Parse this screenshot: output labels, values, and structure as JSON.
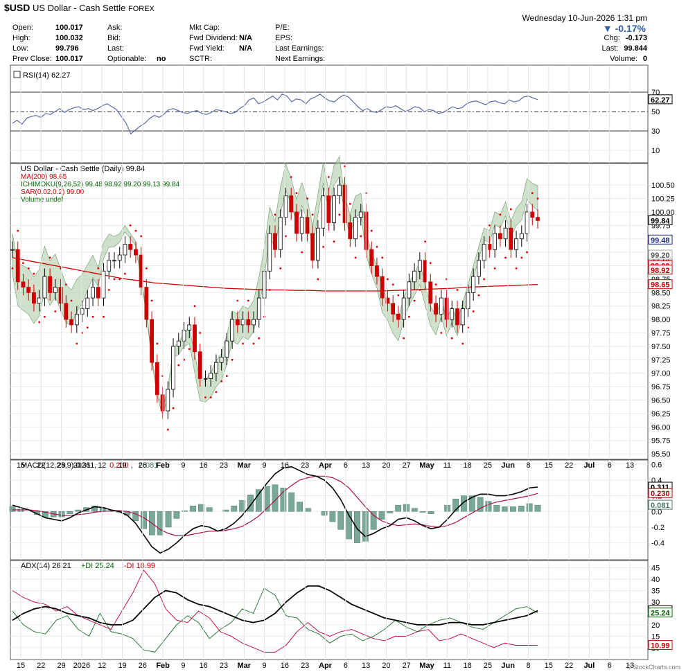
{
  "header": {
    "symbol": "$USD",
    "name": "US Dollar - Cash Settle",
    "exchange": "FOREX",
    "datetime": "Wednesday  10-Jun-2026  1:31 pm",
    "brand": "© StockCharts.com",
    "change_pct": "-0.17%",
    "quotes": [
      {
        "label": "Open:",
        "value": "100.017"
      },
      {
        "label": "High:",
        "value": "100.032"
      },
      {
        "label": "Low:",
        "value": "99.796"
      },
      {
        "label": "Prev Close:",
        "value": "100.017"
      },
      {
        "label": "Ask:",
        "value": ""
      },
      {
        "label": "Bid:",
        "value": ""
      },
      {
        "label": "Last:",
        "value": ""
      },
      {
        "label": "Optionable:",
        "value": "no"
      },
      {
        "label": "Mkt Cap:",
        "value": ""
      },
      {
        "label": "Fwd Dividend:",
        "value": "N/A"
      },
      {
        "label": "Fwd Yield:",
        "value": "N/A"
      },
      {
        "label": "SCTR:",
        "value": ""
      },
      {
        "label": "P/E:",
        "value": ""
      },
      {
        "label": "EPS:",
        "value": ""
      },
      {
        "label": "Last Earnings:",
        "value": ""
      },
      {
        "label": "Next Earnings:",
        "value": ""
      },
      {
        "label": "Chg:",
        "value": "-0.173"
      },
      {
        "label": "Last:",
        "value": "99.844"
      },
      {
        "label": "Volume:",
        "value": "0"
      }
    ]
  },
  "chart_data": {
    "type": "line",
    "x_labels": [
      "15",
      "22",
      "29",
      "2026",
      "12",
      "19",
      "26",
      "Feb",
      "9",
      "16",
      "23",
      "Mar",
      "9",
      "16",
      "23",
      "Apr",
      "6",
      "13",
      "20",
      "27",
      "May",
      "11",
      "18",
      "25",
      "Jun",
      "8",
      "15",
      "22",
      "Jul",
      "6",
      "13"
    ],
    "rsi": {
      "legend": "RSI(14) 62.27",
      "ylim": [
        0,
        95
      ],
      "ticks": [
        70,
        50,
        30,
        10
      ],
      "levels": [
        70,
        50,
        30
      ],
      "last_label": "62.27",
      "values": [
        38,
        41,
        37,
        43,
        45,
        46,
        44,
        48,
        47,
        50,
        53,
        49,
        52,
        54,
        55,
        52,
        53,
        51,
        53,
        56,
        58,
        55,
        52,
        45,
        38,
        27,
        31,
        35,
        38,
        43,
        46,
        44,
        47,
        52,
        53,
        51,
        49,
        48,
        50,
        51,
        48,
        47,
        49,
        52,
        51,
        50,
        48,
        49,
        53,
        56,
        62,
        64,
        58,
        60,
        63,
        66,
        62,
        68,
        66,
        60,
        63,
        62,
        58,
        63,
        65,
        68,
        64,
        61,
        60,
        64,
        67,
        65,
        60,
        55,
        51,
        53,
        50,
        49,
        52,
        55,
        54,
        56,
        53,
        50,
        52,
        55,
        54,
        50,
        52,
        51,
        48,
        49,
        52,
        55,
        53,
        54,
        58,
        60,
        61,
        59,
        57,
        60,
        61,
        59,
        58,
        62,
        60,
        61,
        65,
        66,
        64,
        62.27
      ]
    },
    "price": {
      "legend": [
        "US Dollar - Cash Settle (Daily) 99.84",
        "MA(200) 98.65",
        "ICHIMOKU(9,26,52) 99.48 98.92 99.20 99.13 99.84",
        "SAR(0.02,0.2) 99.00",
        "Volume undef"
      ],
      "ylim": [
        95.45,
        100.85
      ],
      "ticks": [
        100.5,
        100.25,
        100.0,
        99.75,
        99.5,
        99.25,
        99.0,
        98.75,
        98.5,
        98.25,
        98.0,
        97.75,
        97.5,
        97.25,
        97.0,
        96.75,
        96.5,
        96.25,
        96.0,
        95.75,
        95.5
      ],
      "tick_labels": [
        "100.50",
        "100.25",
        "100.00",
        "99.75",
        "",
        "99.25",
        "",
        "98.75",
        "98.50",
        "98.25",
        "98.00",
        "97.75",
        "97.50",
        "97.25",
        "97.00",
        "96.75",
        "96.50",
        "96.25",
        "96.00",
        "95.75",
        "95.50"
      ],
      "value_tags": [
        {
          "text": "99.84",
          "value": 99.84,
          "bg": "#ffffff",
          "fg": "#000000",
          "border": "#000000"
        },
        {
          "text": "99.48",
          "value": 99.48,
          "bg": "#ffffff",
          "fg": "#1a237e",
          "border": "#1a237e"
        },
        {
          "text": "99.13",
          "value": 99.13,
          "bg": "#ffffff",
          "fg": "#333333",
          "border": "#555555"
        },
        {
          "text": "99.20",
          "value": 99.2,
          "bg": "#ffffff",
          "fg": "#555555",
          "border": "#aaaaaa"
        },
        {
          "text": "99.00",
          "value": 99.0,
          "bg": "#ffffff",
          "fg": "#cc0000",
          "border": "#cc0000"
        },
        {
          "text": "98.92",
          "value": 98.92,
          "bg": "#ffffff",
          "fg": "#cc0000",
          "border": "#cc0000"
        },
        {
          "text": "98.65",
          "value": 98.65,
          "bg": "#ffffff",
          "fg": "#cc0000",
          "border": "#cc0000"
        }
      ],
      "closes": [
        99.3,
        98.7,
        98.6,
        98.5,
        98.3,
        98.4,
        98.8,
        98.5,
        98.6,
        98.3,
        98.0,
        97.9,
        98.1,
        98.2,
        98.4,
        98.6,
        98.4,
        98.9,
        99.1,
        99.1,
        99.2,
        99.4,
        99.3,
        99.2,
        98.6,
        98.0,
        97.2,
        96.6,
        96.3,
        96.7,
        97.5,
        97.6,
        97.8,
        97.9,
        97.4,
        96.9,
        96.9,
        97.0,
        97.2,
        97.3,
        97.6,
        98.0,
        97.9,
        98.0,
        97.9,
        98.0,
        98.4,
        98.9,
        99.6,
        99.3,
        99.9,
        100.3,
        100.0,
        99.6,
        99.9,
        99.6,
        99.1,
        99.7,
        100.3,
        99.8,
        100.3,
        100.5,
        99.8,
        99.5,
        99.9,
        100.0,
        99.3,
        99.0,
        98.8,
        98.4,
        98.3,
        98.1,
        98.0,
        98.4,
        98.7,
        98.9,
        99.1,
        98.7,
        98.3,
        98.1,
        98.4,
        98.0,
        98.2,
        97.9,
        98.2,
        98.5,
        98.8,
        99.1,
        99.4,
        99.3,
        99.6,
        99.5,
        99.7,
        99.3,
        99.5,
        99.6,
        100.0,
        99.9,
        99.84
      ],
      "ma200": [
        99.15,
        99.1,
        99.05,
        99.0,
        98.95,
        98.9,
        98.85,
        98.8,
        98.75,
        98.72,
        98.68,
        98.66,
        98.64,
        98.62,
        98.6,
        98.58,
        98.57,
        98.56,
        98.55,
        98.55,
        98.54,
        98.54,
        98.53,
        98.53,
        98.53,
        98.53,
        98.53,
        98.54,
        98.55,
        98.56,
        98.57,
        98.58,
        98.6,
        98.61,
        98.62,
        98.63,
        98.64,
        98.65
      ]
    },
    "macd": {
      "legend": "MACD(12,26,9) 0.311, 0.230, 0.081",
      "legend_parts": [
        "MACD(12,26,9) 0.311, ",
        "0.230",
        ", ",
        "0.081"
      ],
      "ylim": [
        -0.58,
        0.62
      ],
      "ticks": [
        0.6,
        0.4,
        0.2,
        0.0,
        -0.2,
        -0.4
      ],
      "tick_labels": [
        "0.6",
        "0.4",
        "0.2",
        "0.0",
        "-0.2",
        "-0.4"
      ],
      "value_tags": [
        {
          "text": "0.311",
          "value": 0.311,
          "fg": "#000000",
          "border": "#000000"
        },
        {
          "text": "0.230",
          "value": 0.23,
          "fg": "#aa0000",
          "border": "#aa0000"
        },
        {
          "text": "0.081",
          "value": 0.081,
          "fg": "#4a7a6a",
          "border": "#4a7a6a"
        }
      ],
      "macd": [
        0.08,
        0.05,
        0.02,
        -0.03,
        -0.08,
        -0.1,
        -0.12,
        -0.08,
        -0.02,
        0.02,
        0.06,
        0.05,
        0.02,
        0.0,
        -0.05,
        -0.15,
        -0.3,
        -0.45,
        -0.53,
        -0.48,
        -0.4,
        -0.3,
        -0.22,
        -0.18,
        -0.2,
        -0.25,
        -0.22,
        -0.15,
        -0.05,
        0.08,
        0.22,
        0.36,
        0.48,
        0.55,
        0.57,
        0.52,
        0.47,
        0.45,
        0.4,
        0.3,
        0.15,
        -0.05,
        -0.22,
        -0.32,
        -0.28,
        -0.22,
        -0.18,
        -0.1,
        -0.08,
        -0.12,
        -0.18,
        -0.22,
        -0.2,
        -0.1,
        0.02,
        0.12,
        0.18,
        0.22,
        0.22,
        0.2,
        0.2,
        0.22,
        0.25,
        0.3,
        0.311
      ],
      "signal": [
        0.02,
        0.02,
        0.02,
        0.01,
        -0.01,
        -0.03,
        -0.05,
        -0.05,
        -0.04,
        -0.03,
        -0.01,
        0.0,
        0.01,
        0.01,
        0.0,
        -0.03,
        -0.08,
        -0.15,
        -0.23,
        -0.28,
        -0.31,
        -0.31,
        -0.29,
        -0.27,
        -0.25,
        -0.25,
        -0.24,
        -0.22,
        -0.19,
        -0.13,
        -0.06,
        0.04,
        0.14,
        0.25,
        0.33,
        0.4,
        0.43,
        0.45,
        0.45,
        0.43,
        0.38,
        0.3,
        0.18,
        0.06,
        -0.05,
        -0.12,
        -0.16,
        -0.18,
        -0.17,
        -0.16,
        -0.17,
        -0.19,
        -0.2,
        -0.18,
        -0.14,
        -0.08,
        -0.02,
        0.04,
        0.09,
        0.12,
        0.14,
        0.16,
        0.18,
        0.2,
        0.23
      ]
    },
    "adx": {
      "legend_parts": [
        "ADX(14) 26.21 ",
        "+DI 25.24 ",
        "-DI 10.99"
      ],
      "ylim": [
        6,
        47
      ],
      "ticks": [
        45,
        40,
        35,
        30,
        25,
        20,
        15,
        10
      ],
      "value_tags": [
        {
          "text": "26.21",
          "value": 26.21,
          "fg": "#000000",
          "border": "#000000"
        },
        {
          "text": "25.24",
          "value": 25.24,
          "fg": "#006600",
          "border": "#006600"
        },
        {
          "text": "10.99",
          "value": 10.99,
          "fg": "#cc0000",
          "border": "#cc0000"
        }
      ],
      "adx": [
        22,
        25,
        27,
        28,
        27,
        25,
        24,
        23,
        21,
        20,
        20,
        22,
        27,
        32,
        35,
        34,
        31,
        29,
        28,
        26,
        24,
        22,
        21,
        22,
        25,
        30,
        34,
        37,
        37,
        35,
        32,
        29,
        27,
        25,
        23,
        22,
        21,
        20,
        20,
        20,
        21,
        21,
        20,
        20,
        21,
        22,
        23,
        24,
        26.21
      ],
      "plus_di": [
        26,
        20,
        17,
        16,
        22,
        24,
        18,
        15,
        25,
        17,
        16,
        14,
        9,
        8,
        14,
        20,
        24,
        21,
        14,
        18,
        21,
        27,
        25,
        36,
        33,
        24,
        23,
        18,
        16,
        12,
        15,
        16,
        13,
        15,
        18,
        22,
        19,
        17,
        20,
        22,
        23,
        21,
        19,
        18,
        21,
        24,
        27,
        28,
        25.24
      ],
      "minus_di": [
        35,
        32,
        30,
        29,
        26,
        28,
        24,
        22,
        20,
        18,
        26,
        34,
        44,
        38,
        27,
        22,
        21,
        26,
        23,
        17,
        15,
        12,
        10,
        8,
        8,
        11,
        17,
        21,
        17,
        15,
        17,
        18,
        16,
        14,
        13,
        15,
        15,
        17,
        18,
        13,
        14,
        16,
        14,
        12,
        10,
        12,
        11,
        11,
        10.99
      ]
    }
  }
}
